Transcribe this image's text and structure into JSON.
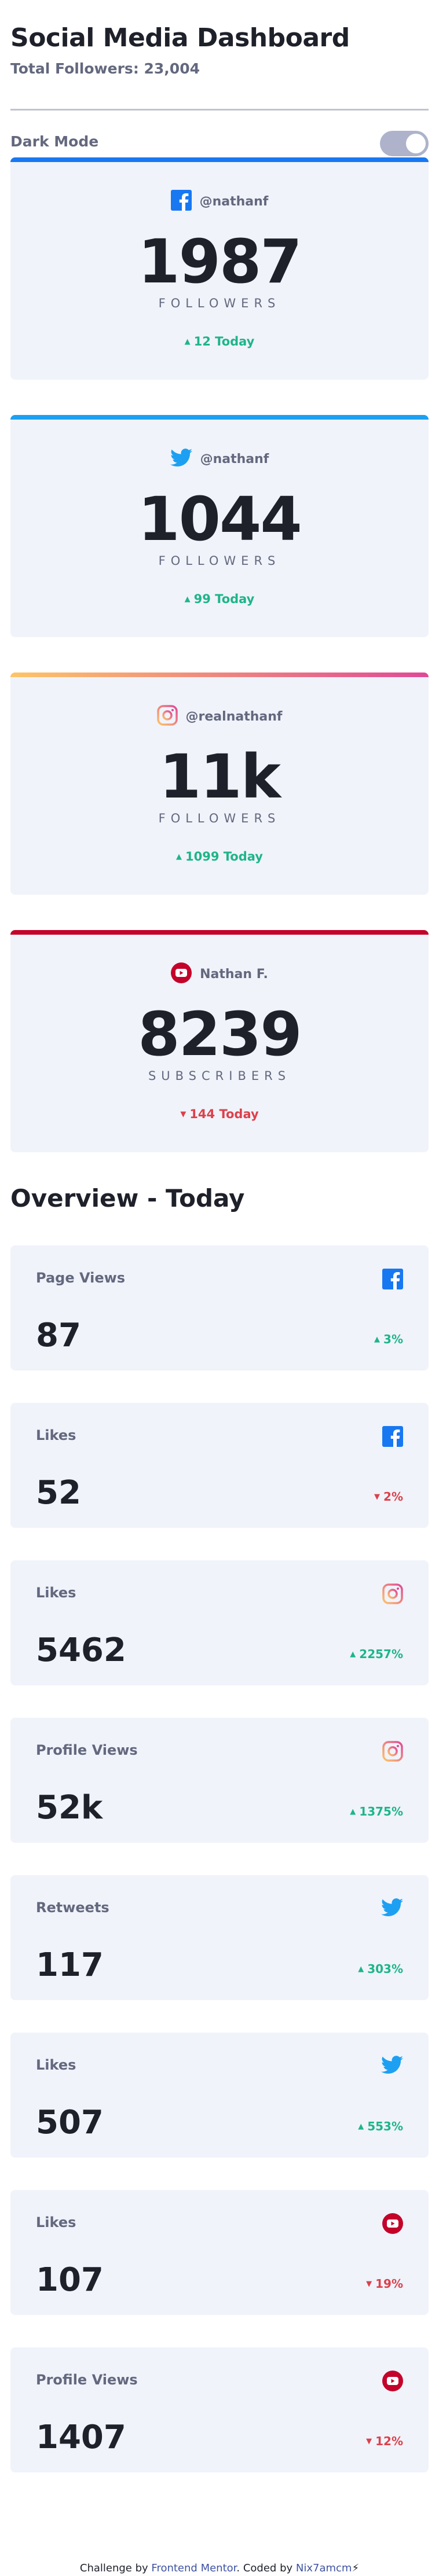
{
  "header": {
    "title": "Social Media Dashboard",
    "total_followers": "Total Followers: 23,004"
  },
  "dark_mode": {
    "label": "Dark Mode",
    "enabled": false
  },
  "colors": {
    "facebook": "#1878f2",
    "twitter": "#1da0f2",
    "instagram_gradient": [
      "#fdc468",
      "#df4996"
    ],
    "youtube": "#c4032a",
    "up": "#1eb589",
    "down": "#dc414c"
  },
  "follower_cards": [
    {
      "platform": "facebook",
      "icon": "facebook-icon",
      "handle": "@nathanf",
      "count": "1987",
      "unit": "FOLLOWERS",
      "delta": "12 Today",
      "direction": "up"
    },
    {
      "platform": "twitter",
      "icon": "twitter-icon",
      "handle": "@nathanf",
      "count": "1044",
      "unit": "FOLLOWERS",
      "delta": "99 Today",
      "direction": "up"
    },
    {
      "platform": "instagram",
      "icon": "instagram-icon",
      "handle": "@realnathanf",
      "count": "11k",
      "unit": "FOLLOWERS",
      "delta": "1099 Today",
      "direction": "up"
    },
    {
      "platform": "youtube",
      "icon": "youtube-icon",
      "handle": "Nathan F.",
      "count": "8239",
      "unit": "SUBSCRIBERS",
      "delta": "144 Today",
      "direction": "down"
    }
  ],
  "overview": {
    "title": "Overview - Today",
    "cards": [
      {
        "metric": "Page Views",
        "platform": "facebook",
        "icon": "facebook-icon",
        "value": "87",
        "change": "3%",
        "direction": "up"
      },
      {
        "metric": "Likes",
        "platform": "facebook",
        "icon": "facebook-icon",
        "value": "52",
        "change": "2%",
        "direction": "down"
      },
      {
        "metric": "Likes",
        "platform": "instagram",
        "icon": "instagram-icon",
        "value": "5462",
        "change": "2257%",
        "direction": "up"
      },
      {
        "metric": "Profile Views",
        "platform": "instagram",
        "icon": "instagram-icon",
        "value": "52k",
        "change": "1375%",
        "direction": "up"
      },
      {
        "metric": "Retweets",
        "platform": "twitter",
        "icon": "twitter-icon",
        "value": "117",
        "change": "303%",
        "direction": "up"
      },
      {
        "metric": "Likes",
        "platform": "twitter",
        "icon": "twitter-icon",
        "value": "507",
        "change": "553%",
        "direction": "up"
      },
      {
        "metric": "Likes",
        "platform": "youtube",
        "icon": "youtube-icon",
        "value": "107",
        "change": "19%",
        "direction": "down"
      },
      {
        "metric": "Profile Views",
        "platform": "youtube",
        "icon": "youtube-icon",
        "value": "1407",
        "change": "12%",
        "direction": "down"
      }
    ]
  },
  "footer": {
    "prefix": "Challenge by ",
    "link1": "Frontend Mentor",
    "middle": ". Coded by ",
    "link2": "Nix7amcm",
    "suffix": "⚡"
  }
}
